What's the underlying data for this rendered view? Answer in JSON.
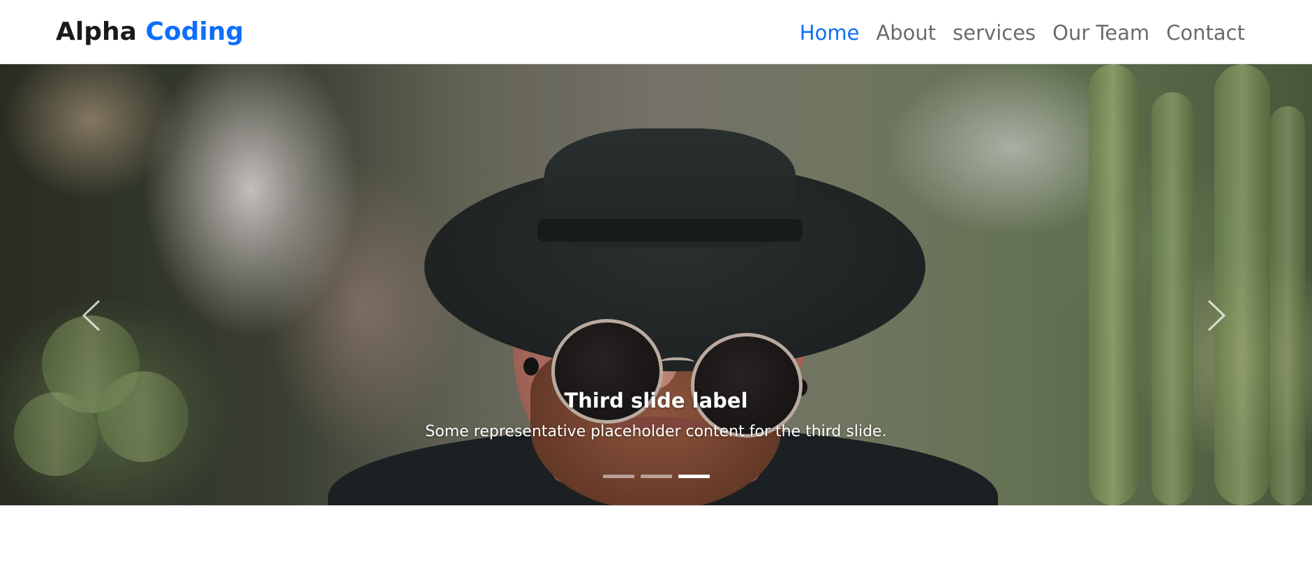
{
  "brand": {
    "part1": "Alpha",
    "part2": "Coding",
    "accent_color": "#0d6efd"
  },
  "nav": {
    "items": [
      {
        "label": "Home",
        "active": true
      },
      {
        "label": "About",
        "active": false
      },
      {
        "label": "services",
        "active": false
      },
      {
        "label": "Our Team",
        "active": false
      },
      {
        "label": "Contact",
        "active": false
      }
    ]
  },
  "carousel": {
    "slide_count": 3,
    "active_index": 2,
    "caption_title": "Third slide label",
    "caption_text": "Some representative placeholder content for the third slide.",
    "prev_icon": "chevron-left-icon",
    "next_icon": "chevron-right-icon"
  }
}
